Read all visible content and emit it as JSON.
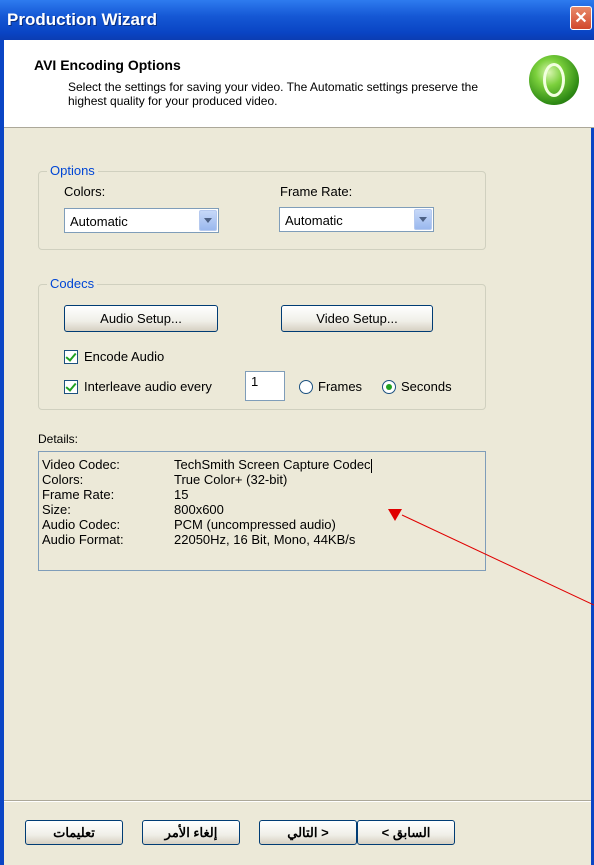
{
  "window": {
    "title": "Production Wizard",
    "close_glyph": "✕"
  },
  "header": {
    "title": "AVI Encoding Options",
    "subtitle": "Select the settings for saving your video.  The Automatic settings preserve the highest quality for your produced video.",
    "logo_icon": "green-orb-icon"
  },
  "options": {
    "legend": "Options",
    "colors_label": "Colors:",
    "colors_value": "Automatic",
    "frame_rate_label": "Frame Rate:",
    "frame_rate_value": "Automatic"
  },
  "codecs": {
    "legend": "Codecs",
    "audio_setup": "Audio Setup...",
    "video_setup": "Video Setup...",
    "encode_audio_label": "Encode Audio",
    "encode_audio_checked": true,
    "interleave_label": "Interleave audio every",
    "interleave_checked": true,
    "interleave_value": "1",
    "frames_label": "Frames",
    "seconds_label": "Seconds",
    "selected_unit": "Seconds"
  },
  "details": {
    "label": "Details:",
    "rows": [
      {
        "key": "Video Codec:",
        "value": "TechSmith Screen Capture Codec"
      },
      {
        "key": "Colors:",
        "value": "True Color+ (32-bit)"
      },
      {
        "key": "Frame Rate:",
        "value": "15"
      },
      {
        "key": "Size:",
        "value": "800x600"
      },
      {
        "key": "Audio Codec:",
        "value": "PCM (uncompressed audio)"
      },
      {
        "key": "Audio Format:",
        "value": "22050Hz, 16 Bit, Mono, 44KB/s"
      }
    ]
  },
  "footer": {
    "back": "< السابق",
    "next": "التالي >",
    "cancel": "إلغاء الأمر",
    "help": "تعليمات"
  },
  "colors": {
    "titlebar": "#0A45C5",
    "accent_red": "#E00000",
    "legend_blue": "#0046D5"
  }
}
